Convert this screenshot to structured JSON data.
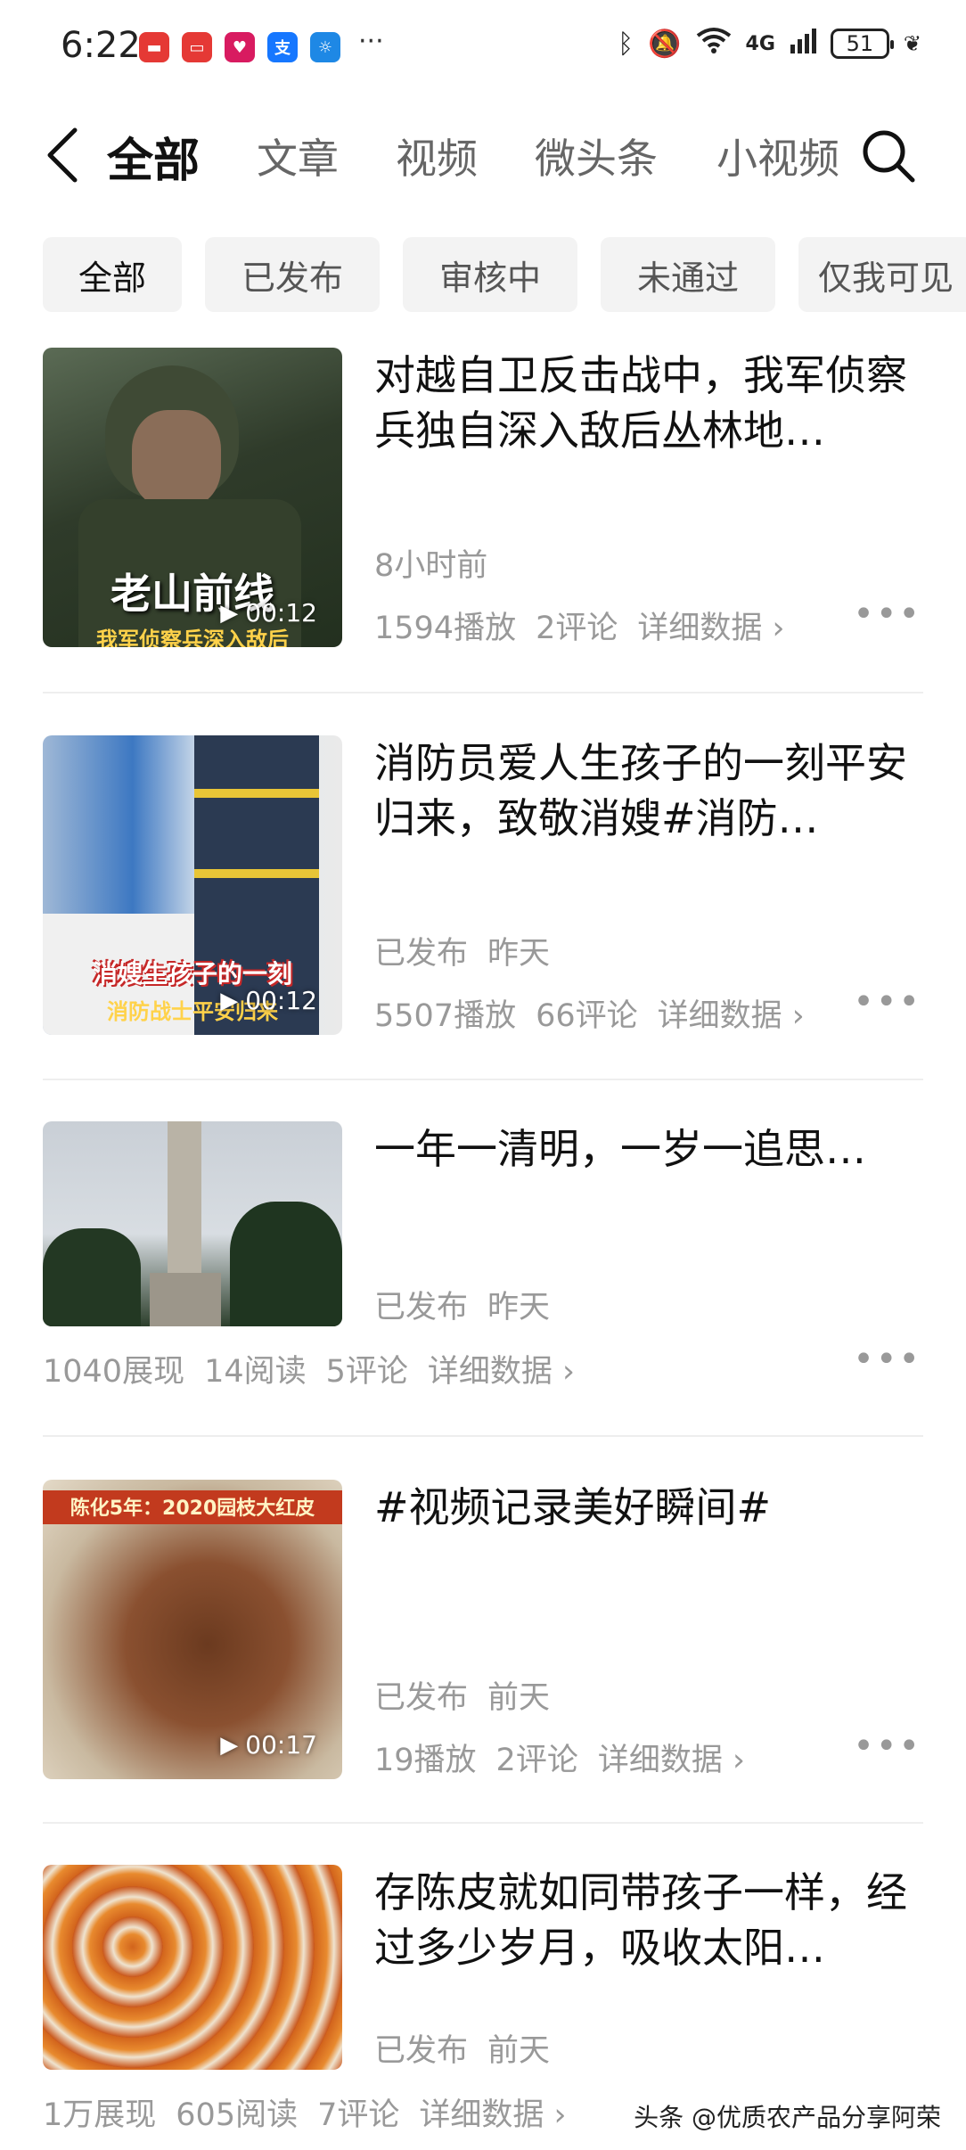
{
  "status_bar": {
    "time": "6:22",
    "apps": [
      {
        "name": "huawei-app-icon",
        "color": "#e53935"
      },
      {
        "name": "tv-app-icon",
        "color": "#e53935"
      },
      {
        "name": "heart-app-icon",
        "color": "#d81b60"
      },
      {
        "name": "alipay-app-icon",
        "color": "#1677ff",
        "glyph": "支"
      },
      {
        "name": "bulb-app-icon",
        "color": "#1e88e5"
      }
    ],
    "more": "···",
    "network": "4G",
    "wifi_index": "6",
    "battery": "51"
  },
  "header": {
    "tabs": [
      "全部",
      "文章",
      "视频",
      "微头条",
      "小视频"
    ]
  },
  "filters": [
    "全部",
    "已发布",
    "审核中",
    "未通过",
    "仅我可见"
  ],
  "items": [
    {
      "title": "对越自卫反击战中，我军侦察兵独自深入敌后丛林地…",
      "time": "8小时前",
      "stats": [
        "1594播放",
        "2评论"
      ],
      "detail": "详细数据 ›",
      "duration": "00:12",
      "overlay": "老山前线",
      "overlay2": "我军侦察兵深入敌后"
    },
    {
      "title": "消防员爱人生孩子的一刻平安归来，致敬消嫂#消防…",
      "status": "已发布",
      "time": "昨天",
      "stats": [
        "5507播放",
        "66评论"
      ],
      "detail": "详细数据 ›",
      "duration": "00:12",
      "overlay": "消嫂生孩子的一刻",
      "overlay2": "消防战士平安归来"
    },
    {
      "title": "一年一清明，一岁一追思…",
      "status": "已发布",
      "time": "昨天",
      "stats": [
        "1040展现",
        "14阅读",
        "5评论"
      ],
      "detail": "详细数据 ›"
    },
    {
      "title": "#视频记录美好瞬间#",
      "status": "已发布",
      "time": "前天",
      "stats": [
        "19播放",
        "2评论"
      ],
      "detail": "详细数据 ›",
      "duration": "00:17",
      "overlay": "陈化5年：2020园枝大红皮"
    },
    {
      "title": "存陈皮就如同带孩子一样，经过多少岁月，吸收太阳…",
      "status": "已发布",
      "time": "前天",
      "stats": [
        "1万展现",
        "605阅读",
        "7评论"
      ],
      "detail": "详细数据 ›"
    }
  ],
  "watermark": "头条 @优质农产品分享阿荣"
}
